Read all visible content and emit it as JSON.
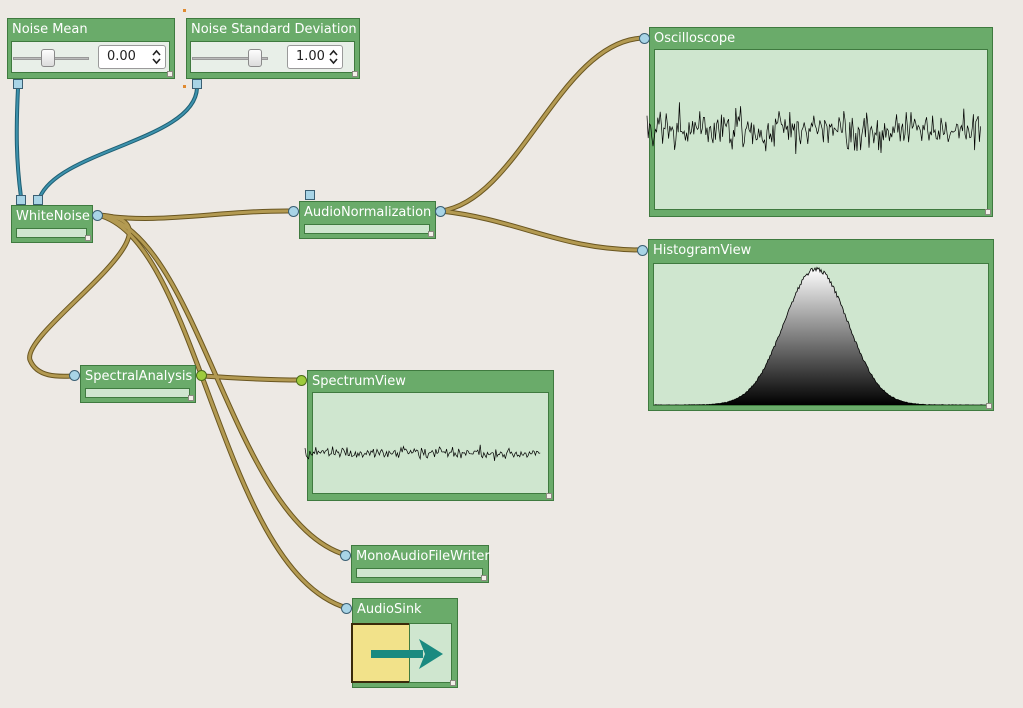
{
  "nodes": {
    "noise_mean": {
      "title": "Noise Mean",
      "value": "0.00",
      "slider_fraction": 0.45
    },
    "noise_std": {
      "title": "Noise Standard Deviation",
      "value": "1.00",
      "slider_fraction": 0.9
    },
    "white_noise": {
      "title": "WhiteNoise"
    },
    "audio_norm": {
      "title": "AudioNormalization"
    },
    "oscilloscope": {
      "title": "Oscilloscope"
    },
    "histogram": {
      "title": "HistogramView"
    },
    "spectral": {
      "title": "SpectralAnalysis"
    },
    "spectrum": {
      "title": "SpectrumView"
    },
    "file_writer": {
      "title": "MonoAudioFileWriter"
    },
    "audio_sink": {
      "title": "AudioSink"
    }
  },
  "colors": {
    "background": "#ede9e4",
    "node_green": "#6aab6a",
    "display_green": "#cfe6cf",
    "wire_audio": "#a38a45",
    "wire_control": "#2f7f9a",
    "port_blue": "#a8d4e6",
    "port_spectrum": "#9ecb3c",
    "sink_yellow": "#f2e28a",
    "arrow_teal": "#1a8a80"
  },
  "icons": {
    "slider_thumb": "slider-thumb-icon",
    "spin_arrows": "spin-arrows-icon",
    "sink_arrow": "arrow-right-icon"
  }
}
